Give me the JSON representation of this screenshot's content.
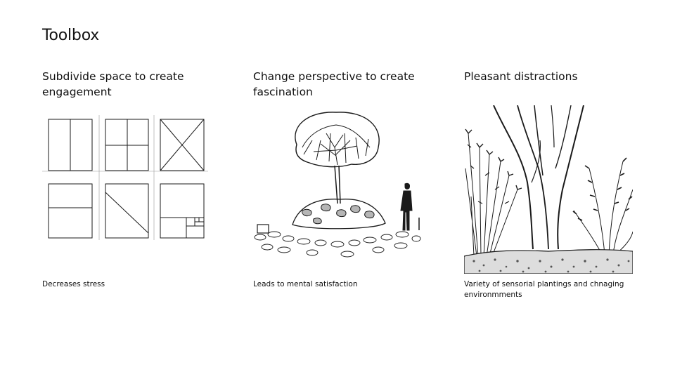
{
  "page": {
    "title": "Toolbox"
  },
  "columns": [
    {
      "heading": "Subdivide space to create engagement",
      "caption": "Decreases stress",
      "sketch_icon": "grid-subdivision-sketch"
    },
    {
      "heading": "Change perspective to create fascination",
      "caption": "Leads to mental satisfaction",
      "sketch_icon": "tree-on-mound-sketch"
    },
    {
      "heading": "Pleasant distractions",
      "caption": "Variety of sensorial plantings and chnaging environmments",
      "sketch_icon": "trees-and-plants-sketch"
    }
  ],
  "colors": {
    "background": "#ffffff",
    "text": "#111111",
    "ink": "#1a1a1a"
  }
}
